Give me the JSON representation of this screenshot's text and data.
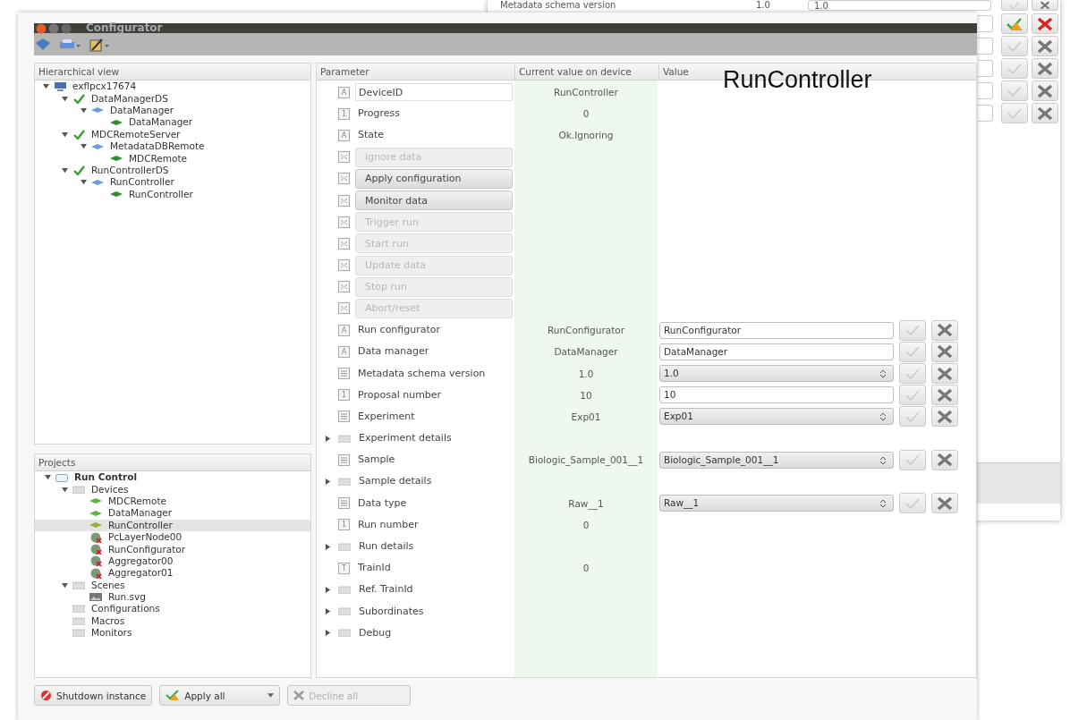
{
  "back_window": {
    "rows": [
      {
        "parameter": "Metadata schema version",
        "current": "1.0",
        "value": "1.0",
        "changed": false
      },
      {
        "changed": true
      },
      {
        "changed": false
      },
      {
        "changed": false
      },
      {
        "changed": false
      },
      {
        "changed": false
      }
    ]
  },
  "window": {
    "title": "Configurator"
  },
  "annotation": "RunController",
  "hierarchical_view": {
    "title": "Hierarchical view",
    "items": [
      {
        "label": "exflpcx17674",
        "kind": "host",
        "expanded": true,
        "selected": false,
        "children": [
          {
            "label": "DataManagerDS",
            "kind": "server",
            "expanded": true,
            "selected": false,
            "children": [
              {
                "label": "DataManager",
                "kind": "class",
                "expanded": true,
                "selected": false,
                "children": [
                  {
                    "label": "DataManager",
                    "kind": "device",
                    "selected": false
                  }
                ]
              }
            ]
          },
          {
            "label": "MDCRemoteServer",
            "kind": "server",
            "expanded": true,
            "selected": false,
            "children": [
              {
                "label": "MetadataDBRemote",
                "kind": "class",
                "expanded": true,
                "selected": false,
                "children": [
                  {
                    "label": "MDCRemote",
                    "kind": "device",
                    "selected": false
                  }
                ]
              }
            ]
          },
          {
            "label": "RunControllerDS",
            "kind": "server",
            "expanded": true,
            "selected": false,
            "children": [
              {
                "label": "RunController",
                "kind": "class",
                "expanded": true,
                "selected": false,
                "children": [
                  {
                    "label": "RunController",
                    "kind": "device",
                    "selected": false
                  }
                ]
              }
            ]
          }
        ]
      }
    ]
  },
  "projects": {
    "title": "Projects",
    "items": [
      {
        "label": "Run Control",
        "kind": "project",
        "expanded": true,
        "selected": false,
        "children": [
          {
            "label": "Devices",
            "kind": "folder",
            "expanded": true,
            "selected": false,
            "children": [
              {
                "label": "MDCRemote",
                "kind": "device",
                "selected": false
              },
              {
                "label": "DataManager",
                "kind": "device",
                "selected": false
              },
              {
                "label": "RunController",
                "kind": "device",
                "selected": true
              },
              {
                "label": "PcLayerNode00",
                "kind": "offline_device",
                "selected": false
              },
              {
                "label": "RunConfigurator",
                "kind": "offline_device",
                "selected": false
              },
              {
                "label": "Aggregator00",
                "kind": "offline_device",
                "selected": false
              },
              {
                "label": "Aggregator01",
                "kind": "offline_device",
                "selected": false
              }
            ]
          },
          {
            "label": "Scenes",
            "kind": "folder",
            "expanded": true,
            "selected": false,
            "children": [
              {
                "label": "Run.svg",
                "kind": "scene",
                "selected": false
              }
            ]
          },
          {
            "label": "Configurations",
            "kind": "folder",
            "selected": false
          },
          {
            "label": "Macros",
            "kind": "folder",
            "selected": false
          },
          {
            "label": "Monitors",
            "kind": "folder",
            "selected": false
          }
        ]
      }
    ]
  },
  "table": {
    "columns": [
      "Parameter",
      "Current value on device",
      "Value"
    ],
    "rows": [
      {
        "name": "DeviceID",
        "kind": "readonly",
        "glyph": "A",
        "current": "RunController",
        "selected": true
      },
      {
        "name": "Progress",
        "kind": "readonly",
        "glyph": "1",
        "current": "0",
        "selected": false
      },
      {
        "name": "State",
        "kind": "readonly",
        "glyph": "A",
        "current": "Ok.Ignoring",
        "selected": false
      },
      {
        "name": "Ignore data",
        "kind": "command",
        "disabled": true,
        "selected": false
      },
      {
        "name": "Apply configuration",
        "kind": "command",
        "disabled": false,
        "selected": false
      },
      {
        "name": "Monitor data",
        "kind": "command",
        "disabled": false,
        "selected": false
      },
      {
        "name": "Trigger run",
        "kind": "command",
        "disabled": true,
        "selected": false
      },
      {
        "name": "Start run",
        "kind": "command",
        "disabled": true,
        "selected": false
      },
      {
        "name": "Update data",
        "kind": "command",
        "disabled": true,
        "selected": false
      },
      {
        "name": "Stop run",
        "kind": "command",
        "disabled": true,
        "selected": false
      },
      {
        "name": "Abort/reset",
        "kind": "command",
        "disabled": true,
        "selected": false
      },
      {
        "name": "Run configurator",
        "kind": "text_field",
        "glyph": "A",
        "current": "RunConfigurator",
        "value": "RunConfigurator",
        "selected": false
      },
      {
        "name": "Data manager",
        "kind": "text_field",
        "glyph": "A",
        "current": "DataManager",
        "value": "DataManager",
        "selected": false
      },
      {
        "name": "Metadata schema version",
        "kind": "combo",
        "current": "1.0",
        "value": "1.0",
        "selected": false
      },
      {
        "name": "Proposal number",
        "kind": "text_field",
        "glyph": "1",
        "current": "10",
        "value": "10",
        "selected": false
      },
      {
        "name": "Experiment",
        "kind": "combo",
        "current": "Exp01",
        "value": "Exp01",
        "selected": false
      },
      {
        "name": "Experiment details",
        "kind": "group",
        "expanded": false,
        "selected": false
      },
      {
        "name": "Sample",
        "kind": "combo",
        "current": "Biologic_Sample_001__1",
        "value": "Biologic_Sample_001__1",
        "selected": false
      },
      {
        "name": "Sample details",
        "kind": "group",
        "expanded": false,
        "selected": false
      },
      {
        "name": "Data type",
        "kind": "combo",
        "current": "Raw__1",
        "value": "Raw__1",
        "selected": false
      },
      {
        "name": "Run number",
        "kind": "readonly",
        "glyph": "1",
        "current": "0",
        "selected": false
      },
      {
        "name": "Run details",
        "kind": "group",
        "expanded": false,
        "selected": false
      },
      {
        "name": "TrainId",
        "kind": "readonly",
        "glyph": "T",
        "current": "0",
        "selected": false
      },
      {
        "name": "Ref. TrainId",
        "kind": "group",
        "expanded": false,
        "selected": false
      },
      {
        "name": "Subordinates",
        "kind": "group",
        "expanded": false,
        "selected": false
      },
      {
        "name": "Debug",
        "kind": "group",
        "expanded": false,
        "selected": false
      }
    ]
  },
  "buttons": [
    {
      "label": "Shutdown instance",
      "kind": "shutdown",
      "disabled": false
    },
    {
      "label": "Apply all",
      "kind": "apply",
      "disabled": false
    },
    {
      "label": "Decline all",
      "kind": "decline",
      "disabled": true
    }
  ]
}
